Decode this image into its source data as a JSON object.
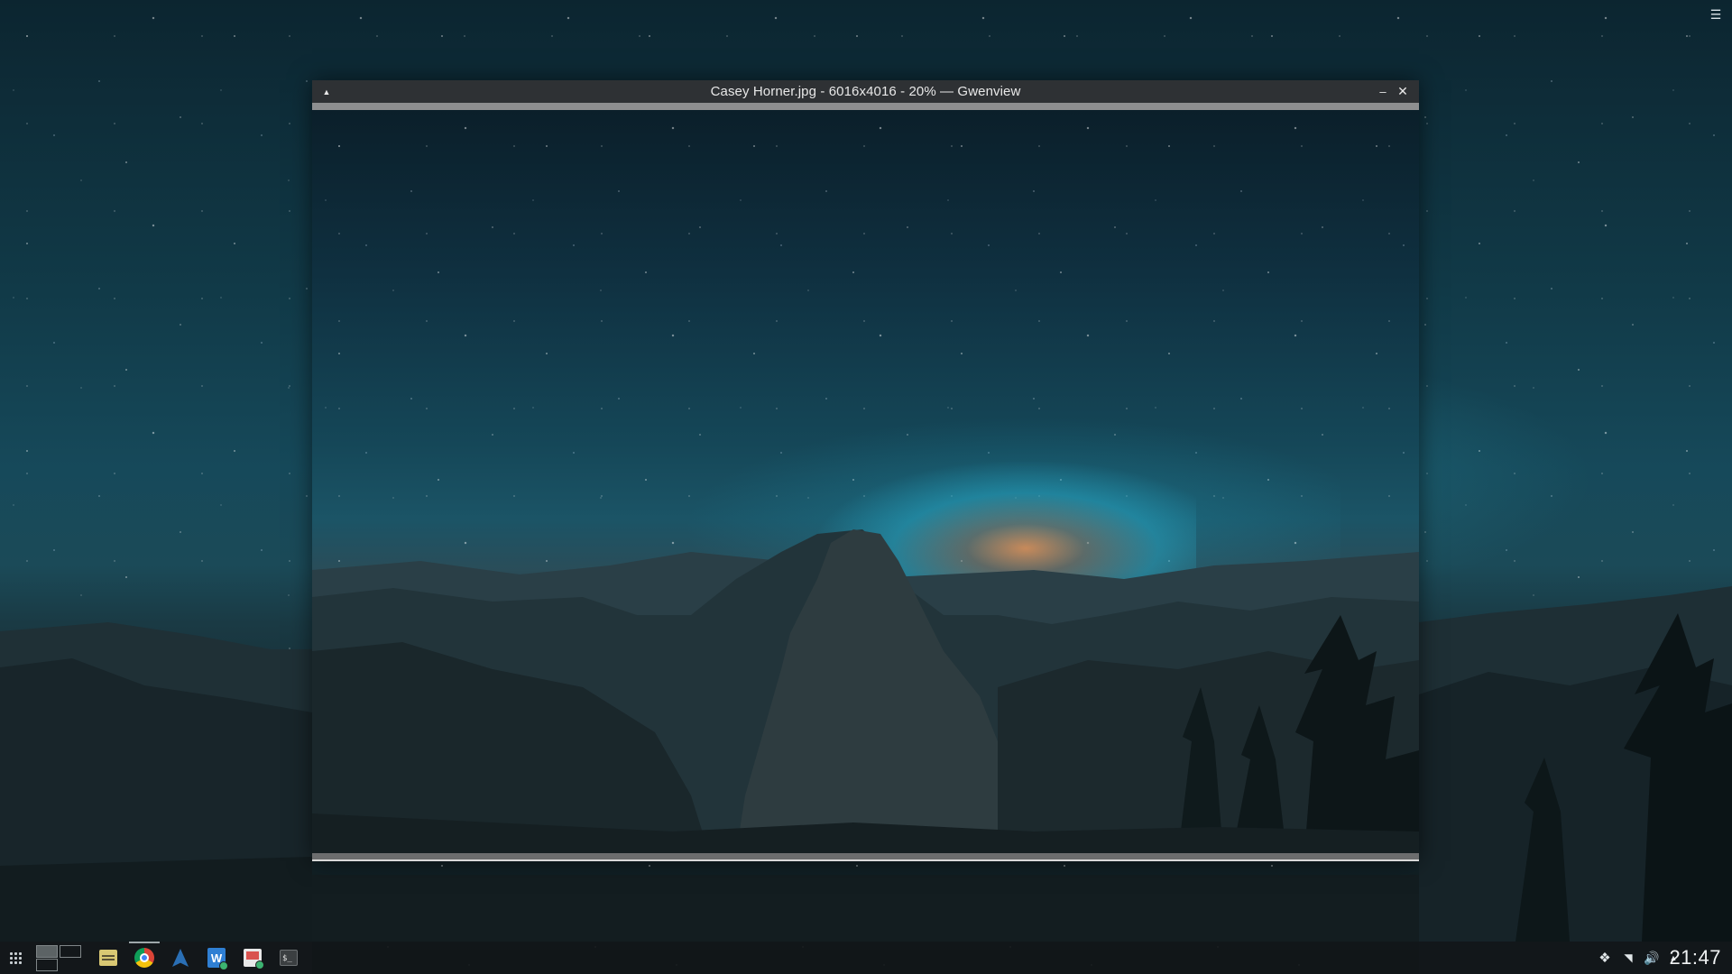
{
  "window": {
    "title": "Casey Horner.jpg - 6016x4016 - 20% — Gwenview"
  },
  "titlebar_buttons": {
    "menu_glyph": "▲",
    "minimize_glyph": "–",
    "close_glyph": "✕"
  },
  "desktop": {
    "menu_glyph": "☰"
  },
  "taskbar": {
    "apps": [
      {
        "name": "file-manager-icon"
      },
      {
        "name": "chrome-icon"
      },
      {
        "name": "arch-icon"
      },
      {
        "name": "writer-icon"
      },
      {
        "name": "presentation-icon"
      },
      {
        "name": "terminal-icon"
      }
    ],
    "tray": {
      "dropbox_glyph": "❖",
      "wifi_glyph": "◥",
      "volume_glyph": "🔊",
      "expand_glyph": "▲"
    },
    "clock": "21:47"
  },
  "colors": {
    "titlebar": "#2e3134",
    "taskbar": "#121618",
    "accent_active": "#9ea7aa"
  }
}
